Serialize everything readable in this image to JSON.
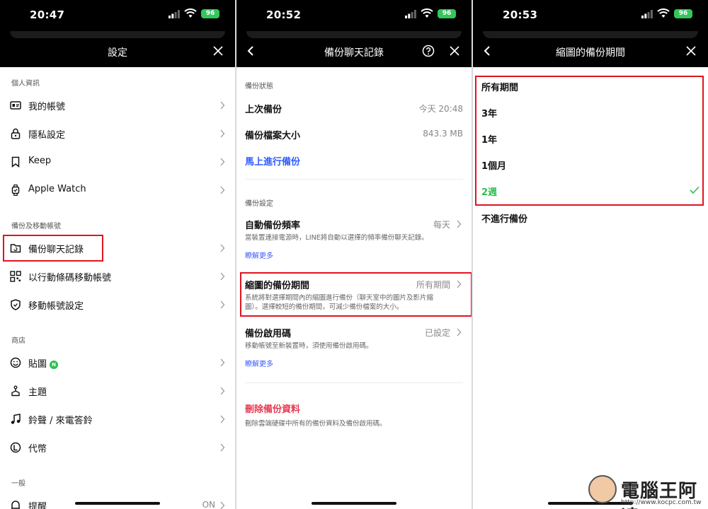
{
  "panel1": {
    "status": {
      "time": "20:47",
      "battery": "96"
    },
    "header": {
      "title": "設定"
    },
    "sections": [
      {
        "label": "個人資訊"
      },
      {
        "label": "備份及移動帳號"
      },
      {
        "label": "商店"
      },
      {
        "label": "一般"
      }
    ],
    "items": [
      {
        "label": "我的帳號",
        "icon": "id-card-icon"
      },
      {
        "label": "隱私設定",
        "icon": "lock-icon"
      },
      {
        "label": "Keep",
        "icon": "bookmark-icon"
      },
      {
        "label": "Apple Watch",
        "icon": "watch-icon"
      },
      {
        "label": "備份聊天記錄",
        "icon": "folder-icon"
      },
      {
        "label": "以行動條碼移動帳號",
        "icon": "qr-code-icon"
      },
      {
        "label": "移動帳號設定",
        "icon": "shield-icon"
      },
      {
        "label": "貼圖",
        "icon": "smiley-icon",
        "badge": "N"
      },
      {
        "label": "主題",
        "icon": "theme-icon"
      },
      {
        "label": "鈴聲 / 來電答鈴",
        "icon": "music-note-icon"
      },
      {
        "label": "代幣",
        "icon": "coin-icon"
      },
      {
        "label": "提醒",
        "icon": "bell-icon",
        "value": "ON"
      }
    ]
  },
  "panel2": {
    "status": {
      "time": "20:52",
      "battery": "96"
    },
    "header": {
      "title": "備份聊天記錄"
    },
    "status_section": {
      "label": "備份狀態",
      "last_backup_label": "上次備份",
      "last_backup_value": "今天 20:48",
      "size_label": "備份檔案大小",
      "size_value": "843.3 MB",
      "backup_now": "馬上進行備份"
    },
    "settings_section": {
      "label": "備份設定",
      "auto": {
        "label": "自動備份頻率",
        "value": "每天",
        "desc": "當裝置連接電源時，LINE將自動以選擇的頻率備份聊天記錄。",
        "more": "瞭解更多"
      },
      "thumb": {
        "label": "縮圖的備份期間",
        "value": "所有期間",
        "desc1": "系統將對選擇期間內的縮圖進行備份（聊天室中的圖片及影片縮",
        "desc2": "圖）。選擇較短的備份期間，可減少備份檔案的大小。"
      },
      "pin": {
        "label": "備份啟用碼",
        "value": "已設定",
        "desc": "移動帳號至新裝置時，須使用備份啟用碼。",
        "more": "瞭解更多"
      }
    },
    "delete": {
      "label": "刪除備份資料",
      "desc": "刪除雲端硬碟中所有的備份資料及備份啟用碼。"
    }
  },
  "panel3": {
    "status": {
      "time": "20:53",
      "battery": "96"
    },
    "header": {
      "title": "縮圖的備份期間"
    },
    "options": [
      {
        "label": "所有期間",
        "selected": false
      },
      {
        "label": "3年",
        "selected": false
      },
      {
        "label": "1年",
        "selected": false
      },
      {
        "label": "1個月",
        "selected": false
      },
      {
        "label": "2週",
        "selected": true
      },
      {
        "label": "不進行備份",
        "selected": false
      }
    ]
  },
  "watermark": {
    "name": "電腦王阿達",
    "url": "http://www.kocpc.com.tw"
  },
  "colors": {
    "highlight": "#e0141e",
    "link": "#2e5bff",
    "danger": "#e53950",
    "selected": "#2fbf4f"
  }
}
